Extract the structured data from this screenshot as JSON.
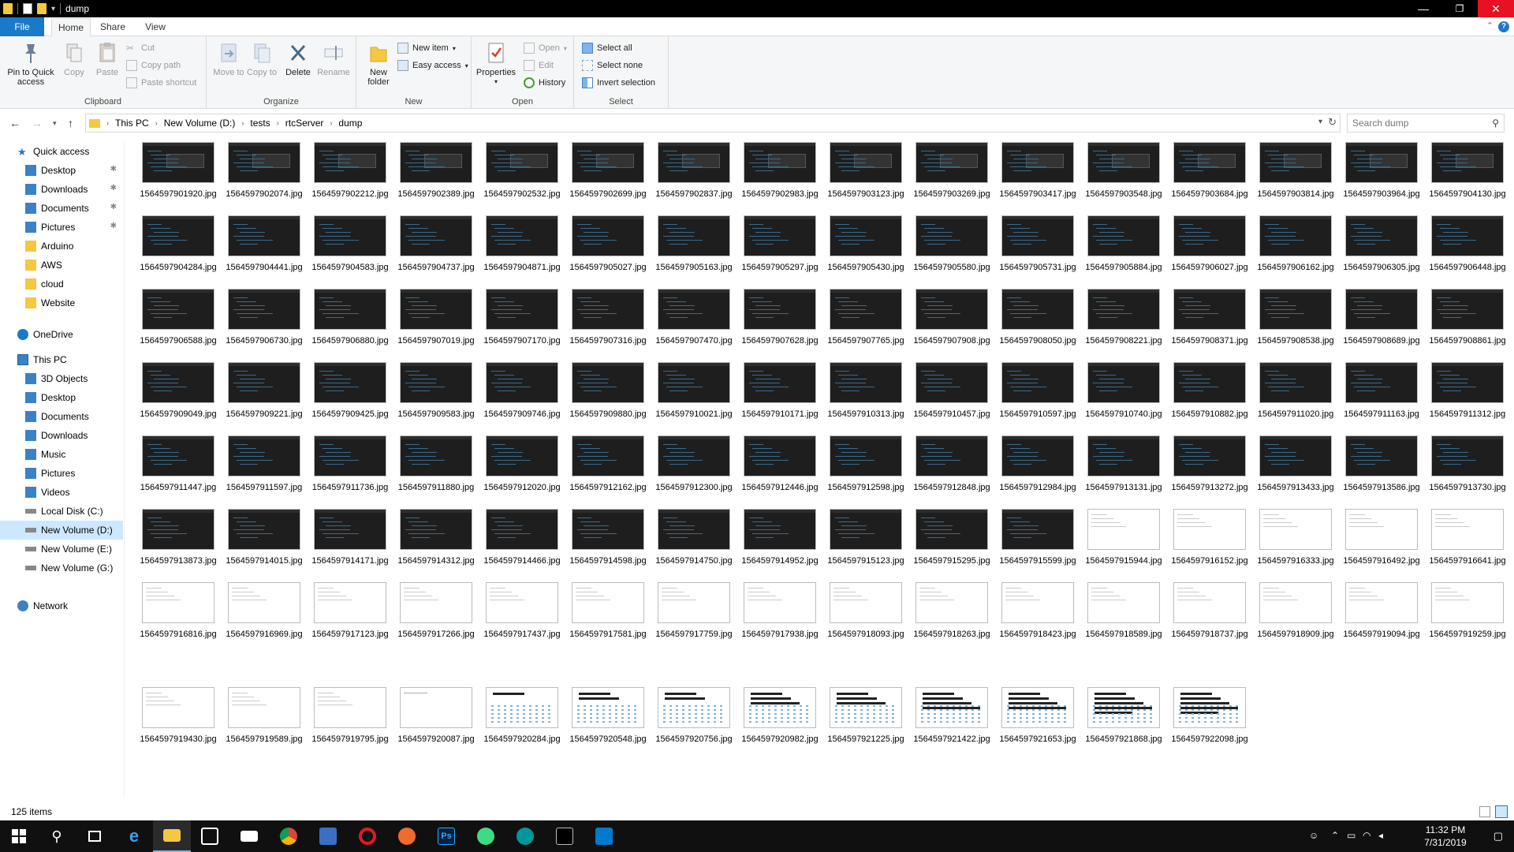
{
  "window": {
    "title": "dump"
  },
  "ribbon_tabs": {
    "file": "File",
    "home": "Home",
    "share": "Share",
    "view": "View"
  },
  "ribbon": {
    "clipboard": {
      "label": "Clipboard",
      "pin": "Pin to Quick access",
      "copy": "Copy",
      "paste": "Paste",
      "cut": "Cut",
      "copy_path": "Copy path",
      "paste_shortcut": "Paste shortcut"
    },
    "organize": {
      "label": "Organize",
      "move_to": "Move to",
      "copy_to": "Copy to",
      "delete": "Delete",
      "rename": "Rename"
    },
    "new": {
      "label": "New",
      "new_folder": "New folder",
      "new_item": "New item",
      "easy_access": "Easy access"
    },
    "open": {
      "label": "Open",
      "properties": "Properties",
      "open": "Open",
      "edit": "Edit",
      "history": "History"
    },
    "select": {
      "label": "Select",
      "select_all": "Select all",
      "select_none": "Select none",
      "invert_selection": "Invert selection"
    }
  },
  "address": {
    "crumbs": [
      "This PC",
      "New Volume (D:)",
      "tests",
      "rtcServer",
      "dump"
    ],
    "search_placeholder": "Search dump"
  },
  "navpane": {
    "quick_access": "Quick access",
    "quick_items": [
      "Desktop",
      "Downloads",
      "Documents",
      "Pictures",
      "Arduino",
      "AWS",
      "cloud",
      "Website"
    ],
    "onedrive": "OneDrive",
    "this_pc": "This PC",
    "pc_items": [
      "3D Objects",
      "Desktop",
      "Documents",
      "Downloads",
      "Music",
      "Pictures",
      "Videos",
      "Local Disk (C:)",
      "New Volume (D:)",
      "New Volume (E:)",
      "New Volume (G:)"
    ],
    "network": "Network"
  },
  "files": [
    "1564597901920.jpg",
    "1564597902074.jpg",
    "1564597902212.jpg",
    "1564597902389.jpg",
    "1564597902532.jpg",
    "1564597902699.jpg",
    "1564597902837.jpg",
    "1564597902983.jpg",
    "1564597903123.jpg",
    "1564597903269.jpg",
    "1564597903417.jpg",
    "1564597903548.jpg",
    "1564597903684.jpg",
    "1564597903814.jpg",
    "1564597903964.jpg",
    "1564597904130.jpg",
    "1564597904284.jpg",
    "1564597904441.jpg",
    "1564597904583.jpg",
    "1564597904737.jpg",
    "1564597904871.jpg",
    "1564597905027.jpg",
    "1564597905163.jpg",
    "1564597905297.jpg",
    "1564597905430.jpg",
    "1564597905580.jpg",
    "1564597905731.jpg",
    "1564597905884.jpg",
    "1564597906027.jpg",
    "1564597906162.jpg",
    "1564597906305.jpg",
    "1564597906448.jpg",
    "1564597906588.jpg",
    "1564597906730.jpg",
    "1564597906880.jpg",
    "1564597907019.jpg",
    "1564597907170.jpg",
    "1564597907316.jpg",
    "1564597907470.jpg",
    "1564597907628.jpg",
    "1564597907765.jpg",
    "1564597907908.jpg",
    "1564597908050.jpg",
    "1564597908221.jpg",
    "1564597908371.jpg",
    "1564597908538.jpg",
    "1564597908689.jpg",
    "1564597908861.jpg",
    "1564597909049.jpg",
    "1564597909221.jpg",
    "1564597909425.jpg",
    "1564597909583.jpg",
    "1564597909746.jpg",
    "1564597909880.jpg",
    "1564597910021.jpg",
    "1564597910171.jpg",
    "1564597910313.jpg",
    "1564597910457.jpg",
    "1564597910597.jpg",
    "1564597910740.jpg",
    "1564597910882.jpg",
    "1564597911020.jpg",
    "1564597911163.jpg",
    "1564597911312.jpg",
    "1564597911447.jpg",
    "1564597911597.jpg",
    "1564597911736.jpg",
    "1564597911880.jpg",
    "1564597912020.jpg",
    "1564597912162.jpg",
    "1564597912300.jpg",
    "1564597912446.jpg",
    "1564597912598.jpg",
    "1564597912848.jpg",
    "1564597912984.jpg",
    "1564597913131.jpg",
    "1564597913272.jpg",
    "1564597913433.jpg",
    "1564597913586.jpg",
    "1564597913730.jpg",
    "1564597913873.jpg",
    "1564597914015.jpg",
    "1564597914171.jpg",
    "1564597914312.jpg",
    "1564597914466.jpg",
    "1564597914598.jpg",
    "1564597914750.jpg",
    "1564597914952.jpg",
    "1564597915123.jpg",
    "1564597915295.jpg",
    "1564597915599.jpg",
    "1564597915944.jpg",
    "1564597916152.jpg",
    "1564597916333.jpg",
    "1564597916492.jpg",
    "1564597916641.jpg",
    "1564597916816.jpg",
    "1564597916969.jpg",
    "1564597917123.jpg",
    "1564597917266.jpg",
    "1564597917437.jpg",
    "1564597917581.jpg",
    "1564597917759.jpg",
    "1564597917938.jpg",
    "1564597918093.jpg",
    "1564597918263.jpg",
    "1564597918423.jpg",
    "1564597918589.jpg",
    "1564597918737.jpg",
    "1564597918909.jpg",
    "1564597919094.jpg",
    "1564597919259.jpg",
    "1564597919430.jpg",
    "1564597919589.jpg",
    "1564597919795.jpg",
    "1564597920087.jpg",
    "1564597920284.jpg",
    "1564597920548.jpg",
    "1564597920756.jpg",
    "1564597920982.jpg",
    "1564597921225.jpg",
    "1564597921422.jpg",
    "1564597921653.jpg",
    "1564597921868.jpg",
    "1564597922098.jpg"
  ],
  "status": {
    "item_count": "125 items"
  },
  "taskbar": {
    "time": "11:32 PM",
    "date": "7/31/2019"
  },
  "colors": {
    "accent": "#1979ca",
    "selection": "#cce8ff",
    "close": "#e81123"
  }
}
